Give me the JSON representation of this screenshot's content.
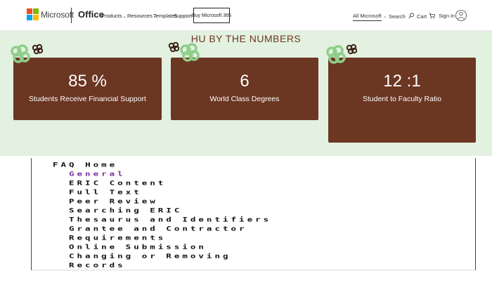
{
  "header": {
    "brand": "Microsoft",
    "product": "Office",
    "logo_colors": [
      "#f25022",
      "#7fba00",
      "#00a4ef",
      "#ffb900"
    ],
    "nav": [
      {
        "label": "Products",
        "chevron": "⌄"
      },
      {
        "label": "Resources",
        "chevron": "⌄"
      },
      {
        "label": "Templates",
        "chevron": ""
      },
      {
        "label": "Support",
        "chevron": ""
      }
    ],
    "buy_label": "Buy Microsoft 365",
    "all_microsoft_label": "All Microsoft",
    "all_microsoft_chevron": "⌄",
    "search_label": "Search",
    "cart_label": "Cart",
    "signin_label": "Sign in"
  },
  "stats": {
    "title": "HU BY THE NUMBERS",
    "accent_color": "#6b3622",
    "background_color": "#e3f1e1",
    "cards": [
      {
        "value": "85 %",
        "label": "Students Receive Financial Support"
      },
      {
        "value": "6",
        "label": "World Class Degrees"
      },
      {
        "value": "12 :1",
        "label": "Student to Faculty Ratio"
      }
    ]
  },
  "faq": {
    "items": [
      {
        "label": "FAQ Home",
        "indent": 0,
        "active": false
      },
      {
        "label": "General",
        "indent": 1,
        "active": true
      },
      {
        "label": "ERIC Content",
        "indent": 1,
        "active": false
      },
      {
        "label": "Full Text",
        "indent": 1,
        "active": false
      },
      {
        "label": "Peer Review",
        "indent": 1,
        "active": false
      },
      {
        "label": "Searching ERIC",
        "indent": 1,
        "active": false
      },
      {
        "label": "Thesaurus and Identifiers",
        "indent": 1,
        "active": false
      },
      {
        "label": "Grantee and Contractor",
        "indent": 1,
        "active": false
      },
      {
        "label": "Requirements",
        "indent": 1,
        "active": false
      },
      {
        "label": "Online Submission",
        "indent": 1,
        "active": false
      },
      {
        "label": "Changing or Removing",
        "indent": 1,
        "active": false
      },
      {
        "label": "Records",
        "indent": 1,
        "active": false
      }
    ]
  }
}
